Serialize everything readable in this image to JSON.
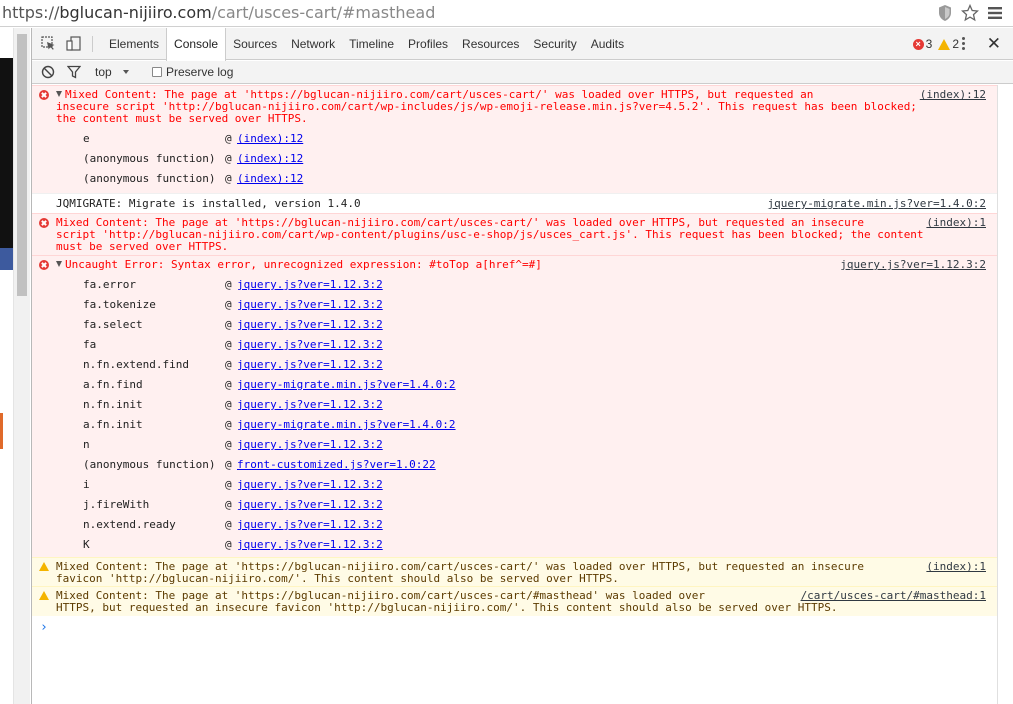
{
  "url": {
    "scheme": "https://",
    "host": "bglucan-nijiiro.com",
    "path": "/cart/usces-cart/#masthead"
  },
  "devtools": {
    "tabs": [
      "Elements",
      "Console",
      "Sources",
      "Network",
      "Timeline",
      "Profiles",
      "Resources",
      "Security",
      "Audits"
    ],
    "active_tab": "Console",
    "error_count": "3",
    "warning_count": "2",
    "filter_context": "top",
    "preserve_log_label": "Preserve log",
    "close_label": "✕"
  },
  "messages": [
    {
      "type": "error",
      "text": "Mixed Content: The page at 'https://bglucan-nijiiro.com/cart/usces-cart/' was loaded over HTTPS, but requested an\ninsecure script 'http://bglucan-nijiiro.com/cart/wp-includes/js/wp-emoji-release.min.js?ver=4.5.2'. This request has been blocked;\nthe content must be served over HTTPS.",
      "source": "(index):12",
      "stack": [
        {
          "fn": "e",
          "loc": "(index):12"
        },
        {
          "fn": "(anonymous function)",
          "loc": "(index):12"
        },
        {
          "fn": "(anonymous function)",
          "loc": "(index):12"
        }
      ]
    },
    {
      "type": "log",
      "text": "JQMIGRATE: Migrate is installed, version 1.4.0",
      "source": "jquery-migrate.min.js?ver=1.4.0:2"
    },
    {
      "type": "error",
      "text": "Mixed Content: The page at 'https://bglucan-nijiiro.com/cart/usces-cart/' was loaded over HTTPS, but requested an insecure\nscript 'http://bglucan-nijiiro.com/cart/wp-content/plugins/usc-e-shop/js/usces_cart.js'. This request has been blocked; the content\nmust be served over HTTPS.",
      "source": "(index):1"
    },
    {
      "type": "error",
      "text": "Uncaught Error: Syntax error, unrecognized expression: #toTop a[href^=#]",
      "source": "jquery.js?ver=1.12.3:2",
      "stack": [
        {
          "fn": "fa.error",
          "loc": "jquery.js?ver=1.12.3:2"
        },
        {
          "fn": "fa.tokenize",
          "loc": "jquery.js?ver=1.12.3:2"
        },
        {
          "fn": "fa.select",
          "loc": "jquery.js?ver=1.12.3:2"
        },
        {
          "fn": "fa",
          "loc": "jquery.js?ver=1.12.3:2"
        },
        {
          "fn": "n.fn.extend.find",
          "loc": "jquery.js?ver=1.12.3:2"
        },
        {
          "fn": "a.fn.find",
          "loc": "jquery-migrate.min.js?ver=1.4.0:2"
        },
        {
          "fn": "n.fn.init",
          "loc": "jquery.js?ver=1.12.3:2"
        },
        {
          "fn": "a.fn.init",
          "loc": "jquery-migrate.min.js?ver=1.4.0:2"
        },
        {
          "fn": "n",
          "loc": "jquery.js?ver=1.12.3:2"
        },
        {
          "fn": "(anonymous function)",
          "loc": "front-customized.js?ver=1.0:22"
        },
        {
          "fn": "i",
          "loc": "jquery.js?ver=1.12.3:2"
        },
        {
          "fn": "j.fireWith",
          "loc": "jquery.js?ver=1.12.3:2"
        },
        {
          "fn": "n.extend.ready",
          "loc": "jquery.js?ver=1.12.3:2"
        },
        {
          "fn": "K",
          "loc": "jquery.js?ver=1.12.3:2"
        }
      ]
    },
    {
      "type": "warn",
      "text": "Mixed Content: The page at 'https://bglucan-nijiiro.com/cart/usces-cart/' was loaded over HTTPS, but requested an insecure\nfavicon 'http://bglucan-nijiiro.com/'. This content should also be served over HTTPS.",
      "source": "(index):1"
    },
    {
      "type": "warn",
      "text": "Mixed Content: The page at 'https://bglucan-nijiiro.com/cart/usces-cart/#masthead' was loaded over\nHTTPS, but requested an insecure favicon 'http://bglucan-nijiiro.com/'. This content should also be served over HTTPS.",
      "source": "/cart/usces-cart/#masthead:1"
    }
  ],
  "prompt_symbol": "›"
}
